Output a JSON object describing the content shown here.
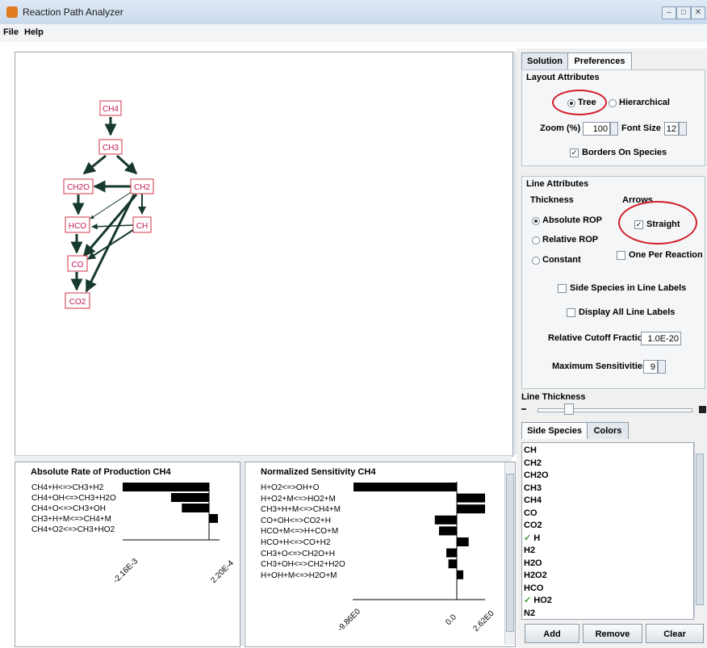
{
  "window": {
    "title": "Reaction Path Analyzer"
  },
  "menu": [
    "File",
    "Help"
  ],
  "graph": {
    "nodes": [
      "CH4",
      "CH3",
      "CH2O",
      "CH2",
      "HCO",
      "CH",
      "CO",
      "CO2"
    ]
  },
  "rop": {
    "title": "Absolute Rate of Production CH4",
    "reactions": [
      "CH4+H<=>CH3+H2",
      "CH4+OH<=>CH3+H2O",
      "CH4+O<=>CH3+OH",
      "CH3+H+M<=>CH4+M",
      "CH4+O2<=>CH3+HO2"
    ],
    "values": [
      -0.00216,
      -0.00095,
      -0.00068,
      0.00022,
      0
    ],
    "axis_min": "-2.16E-3",
    "axis_max": "2.20E-4"
  },
  "sens": {
    "title": "Normalized Sensitivity CH4",
    "reactions": [
      "H+O2<=>OH+O",
      "H+O2+M<=>HO2+M",
      "CH3+H+M<=>CH4+M",
      "CO+OH<=>CO2+H",
      "HCO+M<=>H+CO+M",
      "HCO+H<=>CO+H2",
      "CH3+O<=>CH2O+H",
      "CH3+OH<=>CH2+H2O",
      "H+OH+M<=>H2O+M"
    ],
    "values": [
      -9.86,
      2.62,
      2.62,
      -2.1,
      -1.7,
      1.1,
      -1.0,
      -0.8,
      0.6
    ],
    "axis_min": "-9.86E0",
    "axis_mid": "0.0",
    "axis_max": "2.62E0"
  },
  "prefs": {
    "tabs": [
      "Solution",
      "Preferences"
    ],
    "layout_title": "Layout Attributes",
    "tree": "Tree",
    "hierarchical": "Hierarchical",
    "zoom_label": "Zoom (%)",
    "zoom_value": "100",
    "font_label": "Font Size",
    "font_value": "12",
    "borders": "Borders On Species",
    "line_title": "Line Attributes",
    "thickness_title": "Thickness",
    "arrows_title": "Arrows",
    "absolute": "Absolute ROP",
    "relative": "Relative ROP",
    "constant": "Constant",
    "straight": "Straight",
    "one_per": "One Per Reaction",
    "side_species_labels": "Side Species in Line Labels",
    "display_all": "Display All Line Labels",
    "cutoff_label": "Relative Cutoff Fraction",
    "cutoff_value": "1.0E-20",
    "max_sens_label": "Maximum Sensitivities",
    "max_sens_value": "9",
    "line_thickness": "Line Thickness",
    "line_thickness_level": 0.2
  },
  "side": {
    "tabs": [
      "Side Species",
      "Colors"
    ],
    "items": [
      {
        "label": "CH",
        "checked": false
      },
      {
        "label": "CH2",
        "checked": false
      },
      {
        "label": "CH2O",
        "checked": false
      },
      {
        "label": "CH3",
        "checked": false
      },
      {
        "label": "CH4",
        "checked": false
      },
      {
        "label": "CO",
        "checked": false
      },
      {
        "label": "CO2",
        "checked": false
      },
      {
        "label": "H",
        "checked": true
      },
      {
        "label": "H2",
        "checked": false
      },
      {
        "label": "H2O",
        "checked": false
      },
      {
        "label": "H2O2",
        "checked": false
      },
      {
        "label": "HCO",
        "checked": false
      },
      {
        "label": "HO2",
        "checked": true
      },
      {
        "label": "N2",
        "checked": false
      }
    ],
    "buttons": [
      "Add",
      "Remove",
      "Clear"
    ]
  },
  "colors": {
    "node_border": "#d0334a",
    "node_text": "#c2185b",
    "edge": "#16392b",
    "highlight": "#d21f2b"
  }
}
